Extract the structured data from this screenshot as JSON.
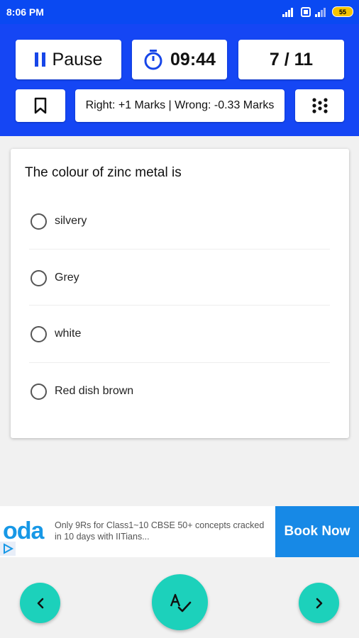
{
  "status_bar": {
    "time": "8:06 PM",
    "battery": "55"
  },
  "header": {
    "pause_label": "Pause",
    "timer": "09:44",
    "counter": "7 / 11",
    "marking_scheme": "Right: +1 Marks | Wrong: -0.33 Marks"
  },
  "question": {
    "text": "The colour of zinc metal is",
    "options": [
      {
        "label": "silvery"
      },
      {
        "label": "Grey"
      },
      {
        "label": "white"
      },
      {
        "label": "Red dish brown"
      }
    ]
  },
  "ad": {
    "logo": "oda",
    "text": "Only 9Rs for Class1~10 CBSE 50+ concepts cracked in 10 days with IITians...",
    "cta": "Book Now"
  },
  "colors": {
    "header_blue": "#1546f4",
    "accent_teal": "#1cd1bb",
    "ad_blue": "#1789e6"
  },
  "icons": {
    "pause": "pause-icon",
    "timer": "stopwatch-icon",
    "bookmark": "bookmark-icon",
    "grid": "dots-grid-icon",
    "prev": "chevron-left-icon",
    "next": "chevron-right-icon",
    "center": "spell-check-icon"
  }
}
